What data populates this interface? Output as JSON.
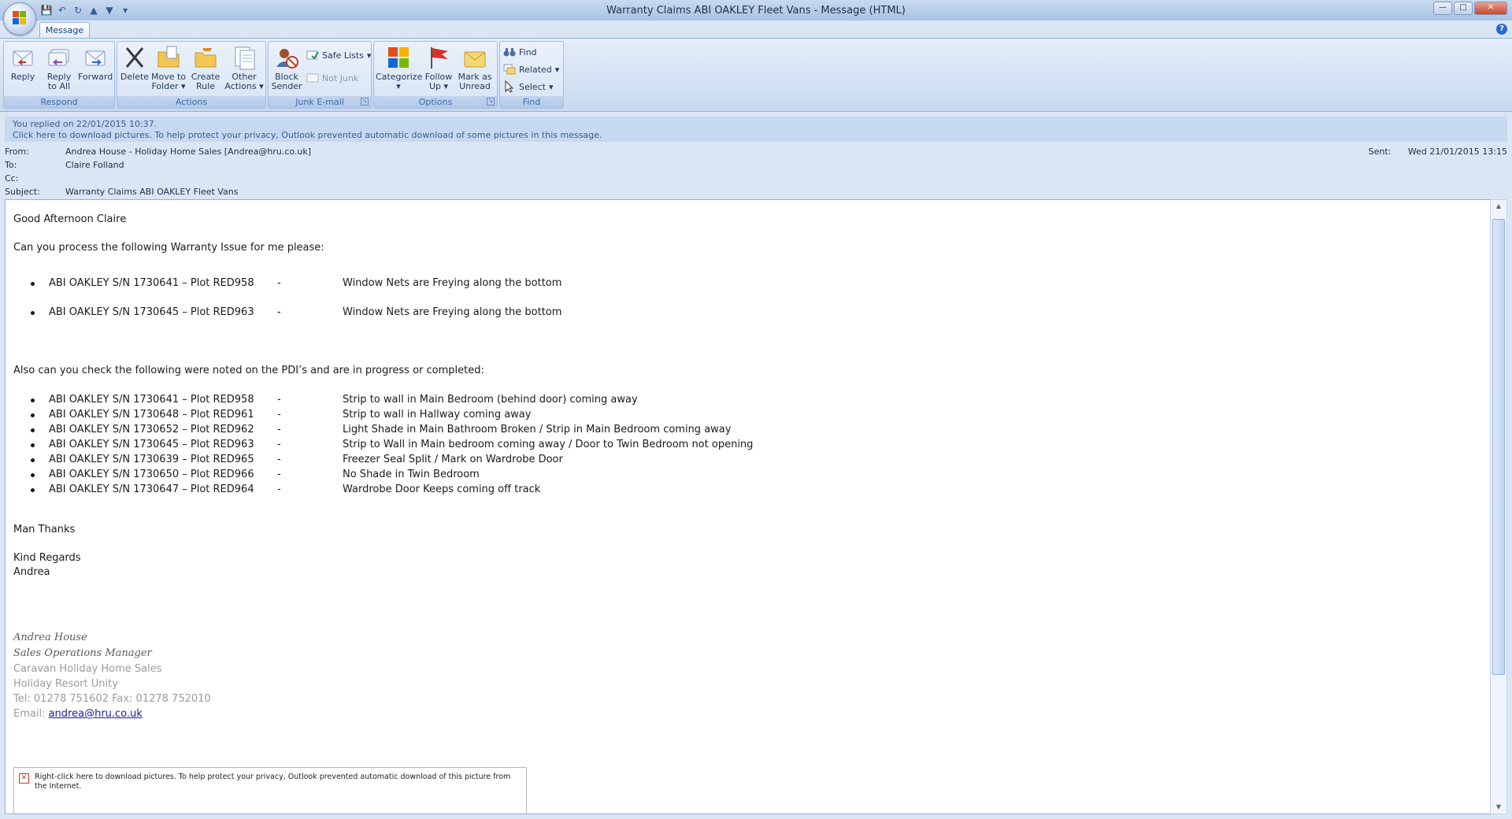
{
  "window": {
    "title": "Warranty Claims ABI OAKLEY Fleet Vans - Message (HTML)"
  },
  "ribbon": {
    "tab": "Message",
    "groups": {
      "respond": {
        "label": "Respond",
        "reply": "Reply",
        "reply_all_1": "Reply",
        "reply_all_2": "to All",
        "forward": "Forward"
      },
      "actions": {
        "label": "Actions",
        "delete": "Delete",
        "move_1": "Move to",
        "move_2": "Folder",
        "create_1": "Create",
        "create_2": "Rule",
        "other_1": "Other",
        "other_2": "Actions"
      },
      "junk": {
        "label": "Junk E-mail",
        "block_1": "Block",
        "block_2": "Sender",
        "safe_lists": "Safe Lists",
        "not_junk": "Not Junk"
      },
      "options": {
        "label": "Options",
        "categorize": "Categorize",
        "follow_1": "Follow",
        "follow_2": "Up",
        "mark_1": "Mark as",
        "mark_2": "Unread"
      },
      "find": {
        "label": "Find",
        "find": "Find",
        "related": "Related",
        "select": "Select"
      }
    }
  },
  "infobar": {
    "line1": "You replied on 22/01/2015 10:37.",
    "line2": "Click here to download pictures. To help protect your privacy, Outlook prevented automatic download of some pictures in this message."
  },
  "header": {
    "from_label": "From:",
    "from": "Andrea House - Holiday Home Sales [Andrea@hru.co.uk]",
    "to_label": "To:",
    "to": "Claire Folland",
    "cc_label": "Cc:",
    "cc": "",
    "subject_label": "Subject:",
    "subject": "Warranty Claims ABI OAKLEY Fleet Vans",
    "sent_label": "Sent:",
    "sent": "Wed 21/01/2015 13:15"
  },
  "body": {
    "greeting": "Good Afternoon Claire",
    "intro": "Can you process the following Warranty Issue for me please:",
    "warranty_items": [
      {
        "unit": "ABI OAKLEY S/N 1730641 – Plot RED958",
        "sep": "-",
        "issue": "Window Nets are Freying along the bottom"
      },
      {
        "unit": "ABI OAKLEY S/N 1730645 – Plot RED963",
        "sep": "-",
        "issue": "Window Nets are Freying along the bottom"
      }
    ],
    "also": "Also can you check the following were noted on the PDI’s and are in progress or completed:",
    "pdi_items": [
      {
        "unit": "ABI OAKLEY S/N 1730641 – Plot RED958",
        "sep": "-",
        "issue": "Strip to wall in Main Bedroom (behind door) coming away"
      },
      {
        "unit": "ABI OAKLEY S/N 1730648 – Plot RED961",
        "sep": "-",
        "issue": "Strip to wall in Hallway coming away"
      },
      {
        "unit": "ABI OAKLEY S/N 1730652 – Plot RED962",
        "sep": "-",
        "issue": "Light Shade in Main Bathroom Broken / Strip in Main Bedroom coming away"
      },
      {
        "unit": "ABI OAKLEY S/N 1730645 – Plot RED963",
        "sep": "-",
        "issue": "Strip to Wall in Main bedroom coming away / Door to Twin Bedroom not opening"
      },
      {
        "unit": "ABI OAKLEY S/N 1730639 – Plot RED965",
        "sep": "-",
        "issue": "Freezer Seal Split / Mark on Wardrobe Door"
      },
      {
        "unit": "ABI OAKLEY S/N 1730650 – Plot RED966",
        "sep": "-",
        "issue": "No Shade in Twin Bedroom"
      },
      {
        "unit": "ABI OAKLEY S/N 1730647 – Plot RED964",
        "sep": "-",
        "issue": "Wardrobe Door Keeps coming off track"
      }
    ],
    "thanks": "Man Thanks",
    "regards": "Kind Regards",
    "name": "Andrea",
    "signature": {
      "name": "Andrea House",
      "title": "Sales Operations Manager",
      "company": "Caravan Holiday Home Sales",
      "resort": "Holiday Resort Unity",
      "tel": "Tel: 01278 751602 Fax: 01278 752010",
      "email_label": "Email: ",
      "email": "andrea@hru.co.uk"
    },
    "image_placeholder": "Right-click here to download pictures.  To help protect your privacy, Outlook prevented automatic download of this picture from the Internet."
  },
  "colors": {
    "ribbon_bg": "#c7d9f0",
    "infobar_bg": "#c5d9f1",
    "link": "#1a1aa6",
    "signature_grey": "#9b9b9b"
  }
}
